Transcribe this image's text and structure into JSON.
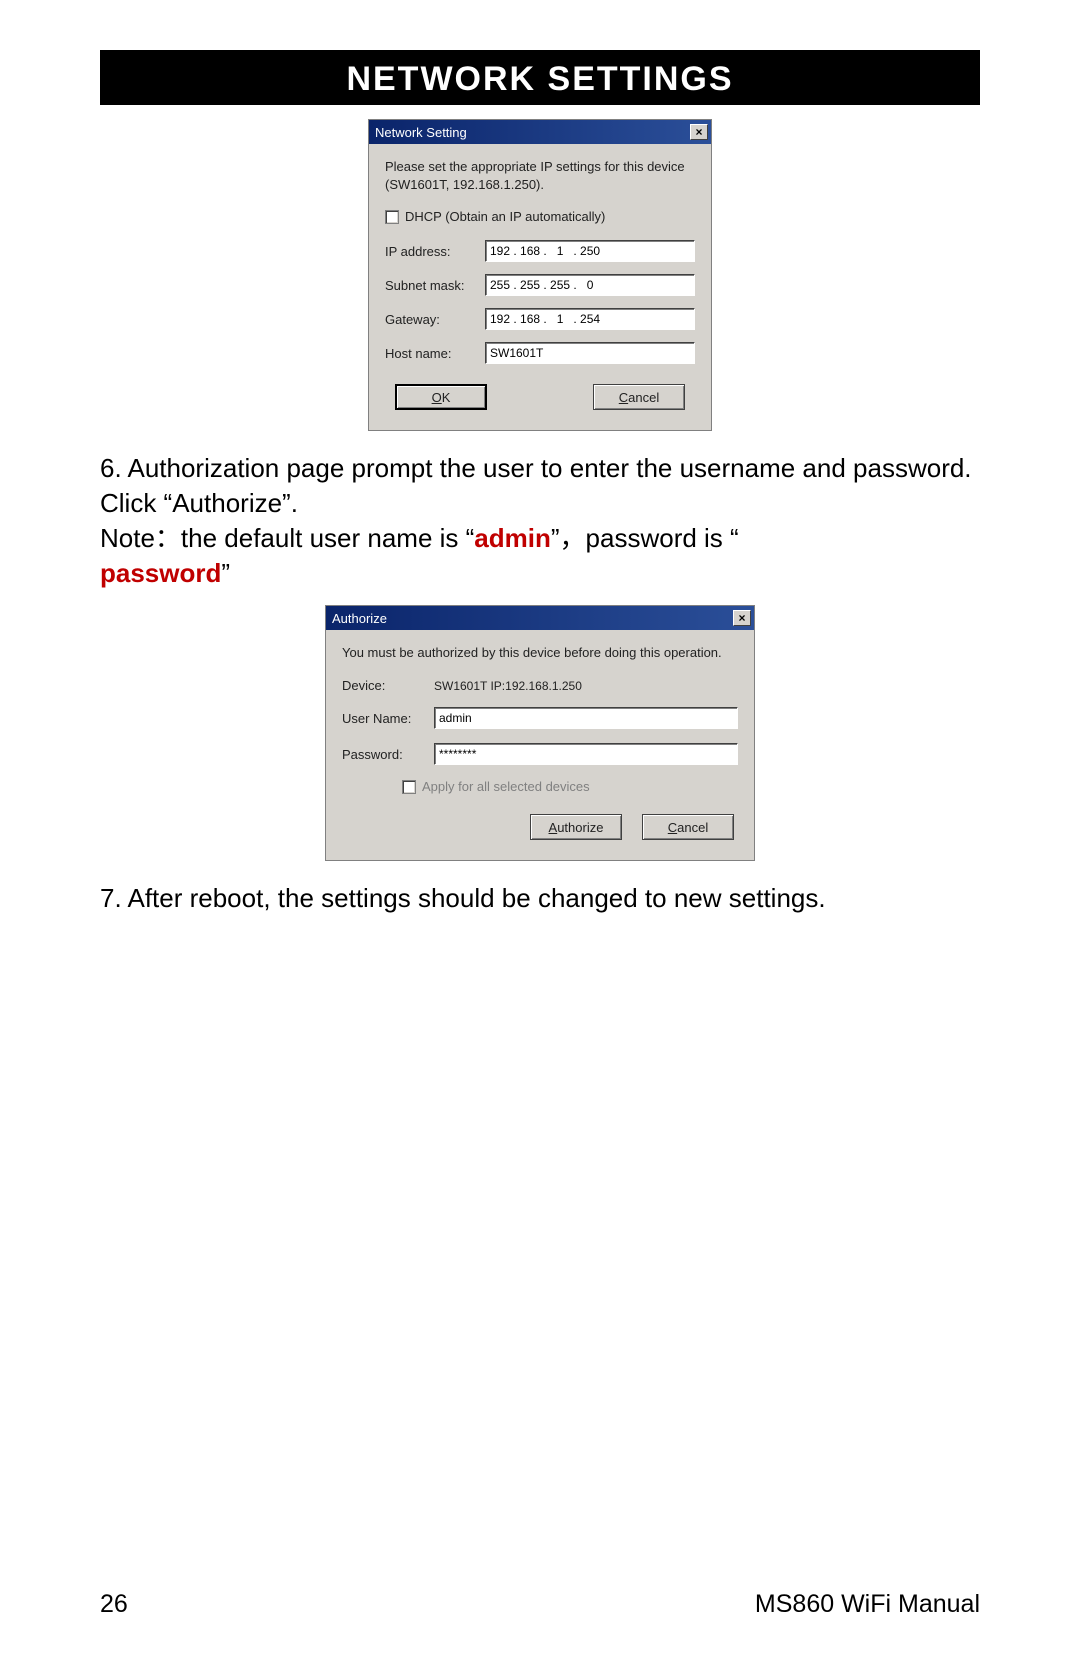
{
  "header": {
    "title": "Network Settings"
  },
  "dialog_network": {
    "title": "Network Setting",
    "instruction": "Please set the appropriate IP settings for this device (SW1601T, 192.168.1.250).",
    "dhcp_label": "DHCP (Obtain an IP automatically)",
    "fields": {
      "ip_label": "IP address:",
      "ip_value": "192 . 168 .   1   . 250",
      "subnet_label": "Subnet mask:",
      "subnet_value": "255 . 255 . 255 .   0",
      "gateway_label": "Gateway:",
      "gateway_value": "192 . 168 .   1   . 254",
      "hostname_label": "Host name:",
      "hostname_value": "SW1601T"
    },
    "ok_label": "OK",
    "cancel_label": "Cancel"
  },
  "step6": {
    "line1": "6. Authorization page prompt the user to enter the username and password. Click “Authorize”.",
    "note_prefix": "Note：the default user name is “",
    "note_admin": "admin",
    "note_mid": "”，password is “ ",
    "note_password": "password",
    "note_suffix": "”"
  },
  "dialog_authorize": {
    "title": "Authorize",
    "instruction": "You must be authorized by this device before doing this operation.",
    "device_label": "Device:",
    "device_value": "SW1601T   IP:192.168.1.250",
    "username_label": "User Name:",
    "username_value": "admin",
    "password_label": "Password:",
    "password_value": "********",
    "apply_all_label": "Apply for all selected devices",
    "authorize_label": "Authorize",
    "cancel_label": "Cancel"
  },
  "step7": {
    "text": "7. After reboot, the settings should be changed to new settings."
  },
  "footer": {
    "page": "26",
    "doc": "MS860 WiFi Manual"
  }
}
